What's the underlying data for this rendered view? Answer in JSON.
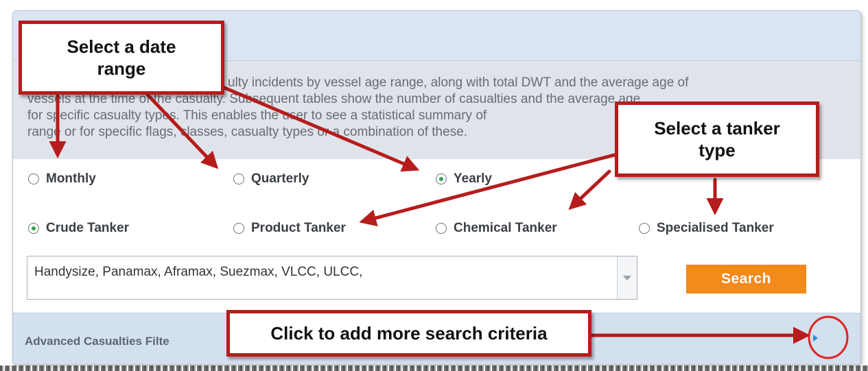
{
  "description": {
    "line1": "ulty incidents by vessel age range, along with total DWT and the average age of",
    "line2": "vessels at the time of the casualty. Subsequent tables show the number of casualties and the average age",
    "line3": "for specific casualty types. This enables the user to see a statistical summary of",
    "line4": "range or for specific flags, classes, casualty types or a combination of these."
  },
  "date_range": {
    "options": [
      {
        "label": "Monthly",
        "checked": false
      },
      {
        "label": "Quarterly",
        "checked": false
      },
      {
        "label": "Yearly",
        "checked": true
      }
    ]
  },
  "tanker_type": {
    "options": [
      {
        "label": "Crude Tanker",
        "checked": true
      },
      {
        "label": "Product Tanker",
        "checked": false
      },
      {
        "label": "Chemical Tanker",
        "checked": false
      },
      {
        "label": "Specialised Tanker",
        "checked": false
      }
    ]
  },
  "vessel_classes": {
    "value": "Handysize, Panamax, Aframax, Suezmax, VLCC, ULCC,"
  },
  "search_button": {
    "label": "Search"
  },
  "advanced_filter": {
    "label": "Advanced Casualties Filte"
  },
  "annotations": {
    "date_range": "Select a date range",
    "tanker_type": "Select a tanker type",
    "more_criteria": "Click to add more search criteria"
  },
  "colors": {
    "accent_orange": "#f28a1c",
    "annotation_red": "#b61c1c",
    "header_blue": "#d9e5f3",
    "radio_green": "#3aa052"
  },
  "icons": {
    "expand": "triangle-right-icon",
    "dropdown": "chevron-down-icon"
  }
}
